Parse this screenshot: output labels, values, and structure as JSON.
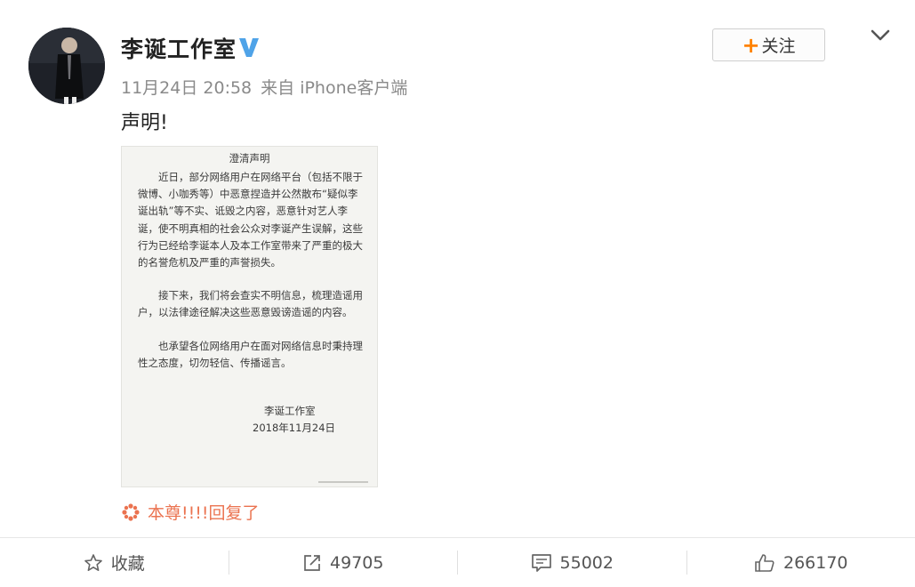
{
  "post": {
    "author": "李诞工作室",
    "timestamp": "11月24日 20:58",
    "source": "来自 iPhone客户端",
    "text": "声明!",
    "follow_label": "关注",
    "follow_plus": "+",
    "reply_text": "本尊!!!!回复了"
  },
  "statement": {
    "title": "澄清声明",
    "para1": "近日，部分网络用户在网络平台（包括不限于微博、小咖秀等）中恶意捏造并公然散布“疑似李诞出轨”等不实、诋毁之内容，恶意针对艺人李诞，使不明真相的社会公众对李诞产生误解，这些行为已经给李诞本人及本工作室带来了严重的极大的名誉危机及严重的声誉损失。",
    "para2": "接下来，我们将会查实不明信息，梳理造谣用户，以法律途径解决这些恶意毁谤造谣的内容。",
    "para3": "也承望各位网络用户在面对网络信息时秉持理性之态度，切勿轻信、传播谣言。",
    "signature": "李诞工作室",
    "date": "2018年11月24日"
  },
  "actions": {
    "favorite": "收藏",
    "repost": "49705",
    "comment": "55002",
    "like": "266170"
  },
  "colors": {
    "accent_orange": "#ff8200",
    "verified_blue": "#4fa3e8",
    "reply_red": "#eb7350",
    "meta_gray": "#8a8a8a"
  },
  "icons": [
    "avatar",
    "verified-icon",
    "chevron-down-icon",
    "star-icon",
    "repost-icon",
    "comment-icon",
    "like-icon",
    "flower-icon"
  ]
}
